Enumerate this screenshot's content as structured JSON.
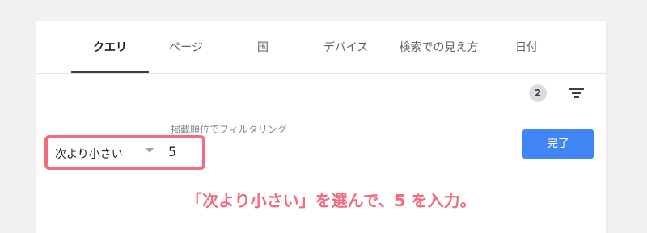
{
  "tabs": [
    {
      "label": "クエリ"
    },
    {
      "label": "ページ"
    },
    {
      "label": "国"
    },
    {
      "label": "デバイス"
    },
    {
      "label": "検索での見え方"
    },
    {
      "label": "日付"
    }
  ],
  "active_tab": "クエリ",
  "filter_badge": "2",
  "filter": {
    "label": "掲載順位でフィルタリング",
    "condition": "次より小さい",
    "value": "5"
  },
  "done_label": "完了",
  "caption": "「次より小さい」を選んで、5 を入力。",
  "colors": {
    "accent": "#4285f4",
    "highlight": "#f26b7f",
    "active_tab": "#3c4043"
  },
  "icons": {
    "filter": "filter-icon",
    "dropdown": "chevron-down-icon"
  }
}
